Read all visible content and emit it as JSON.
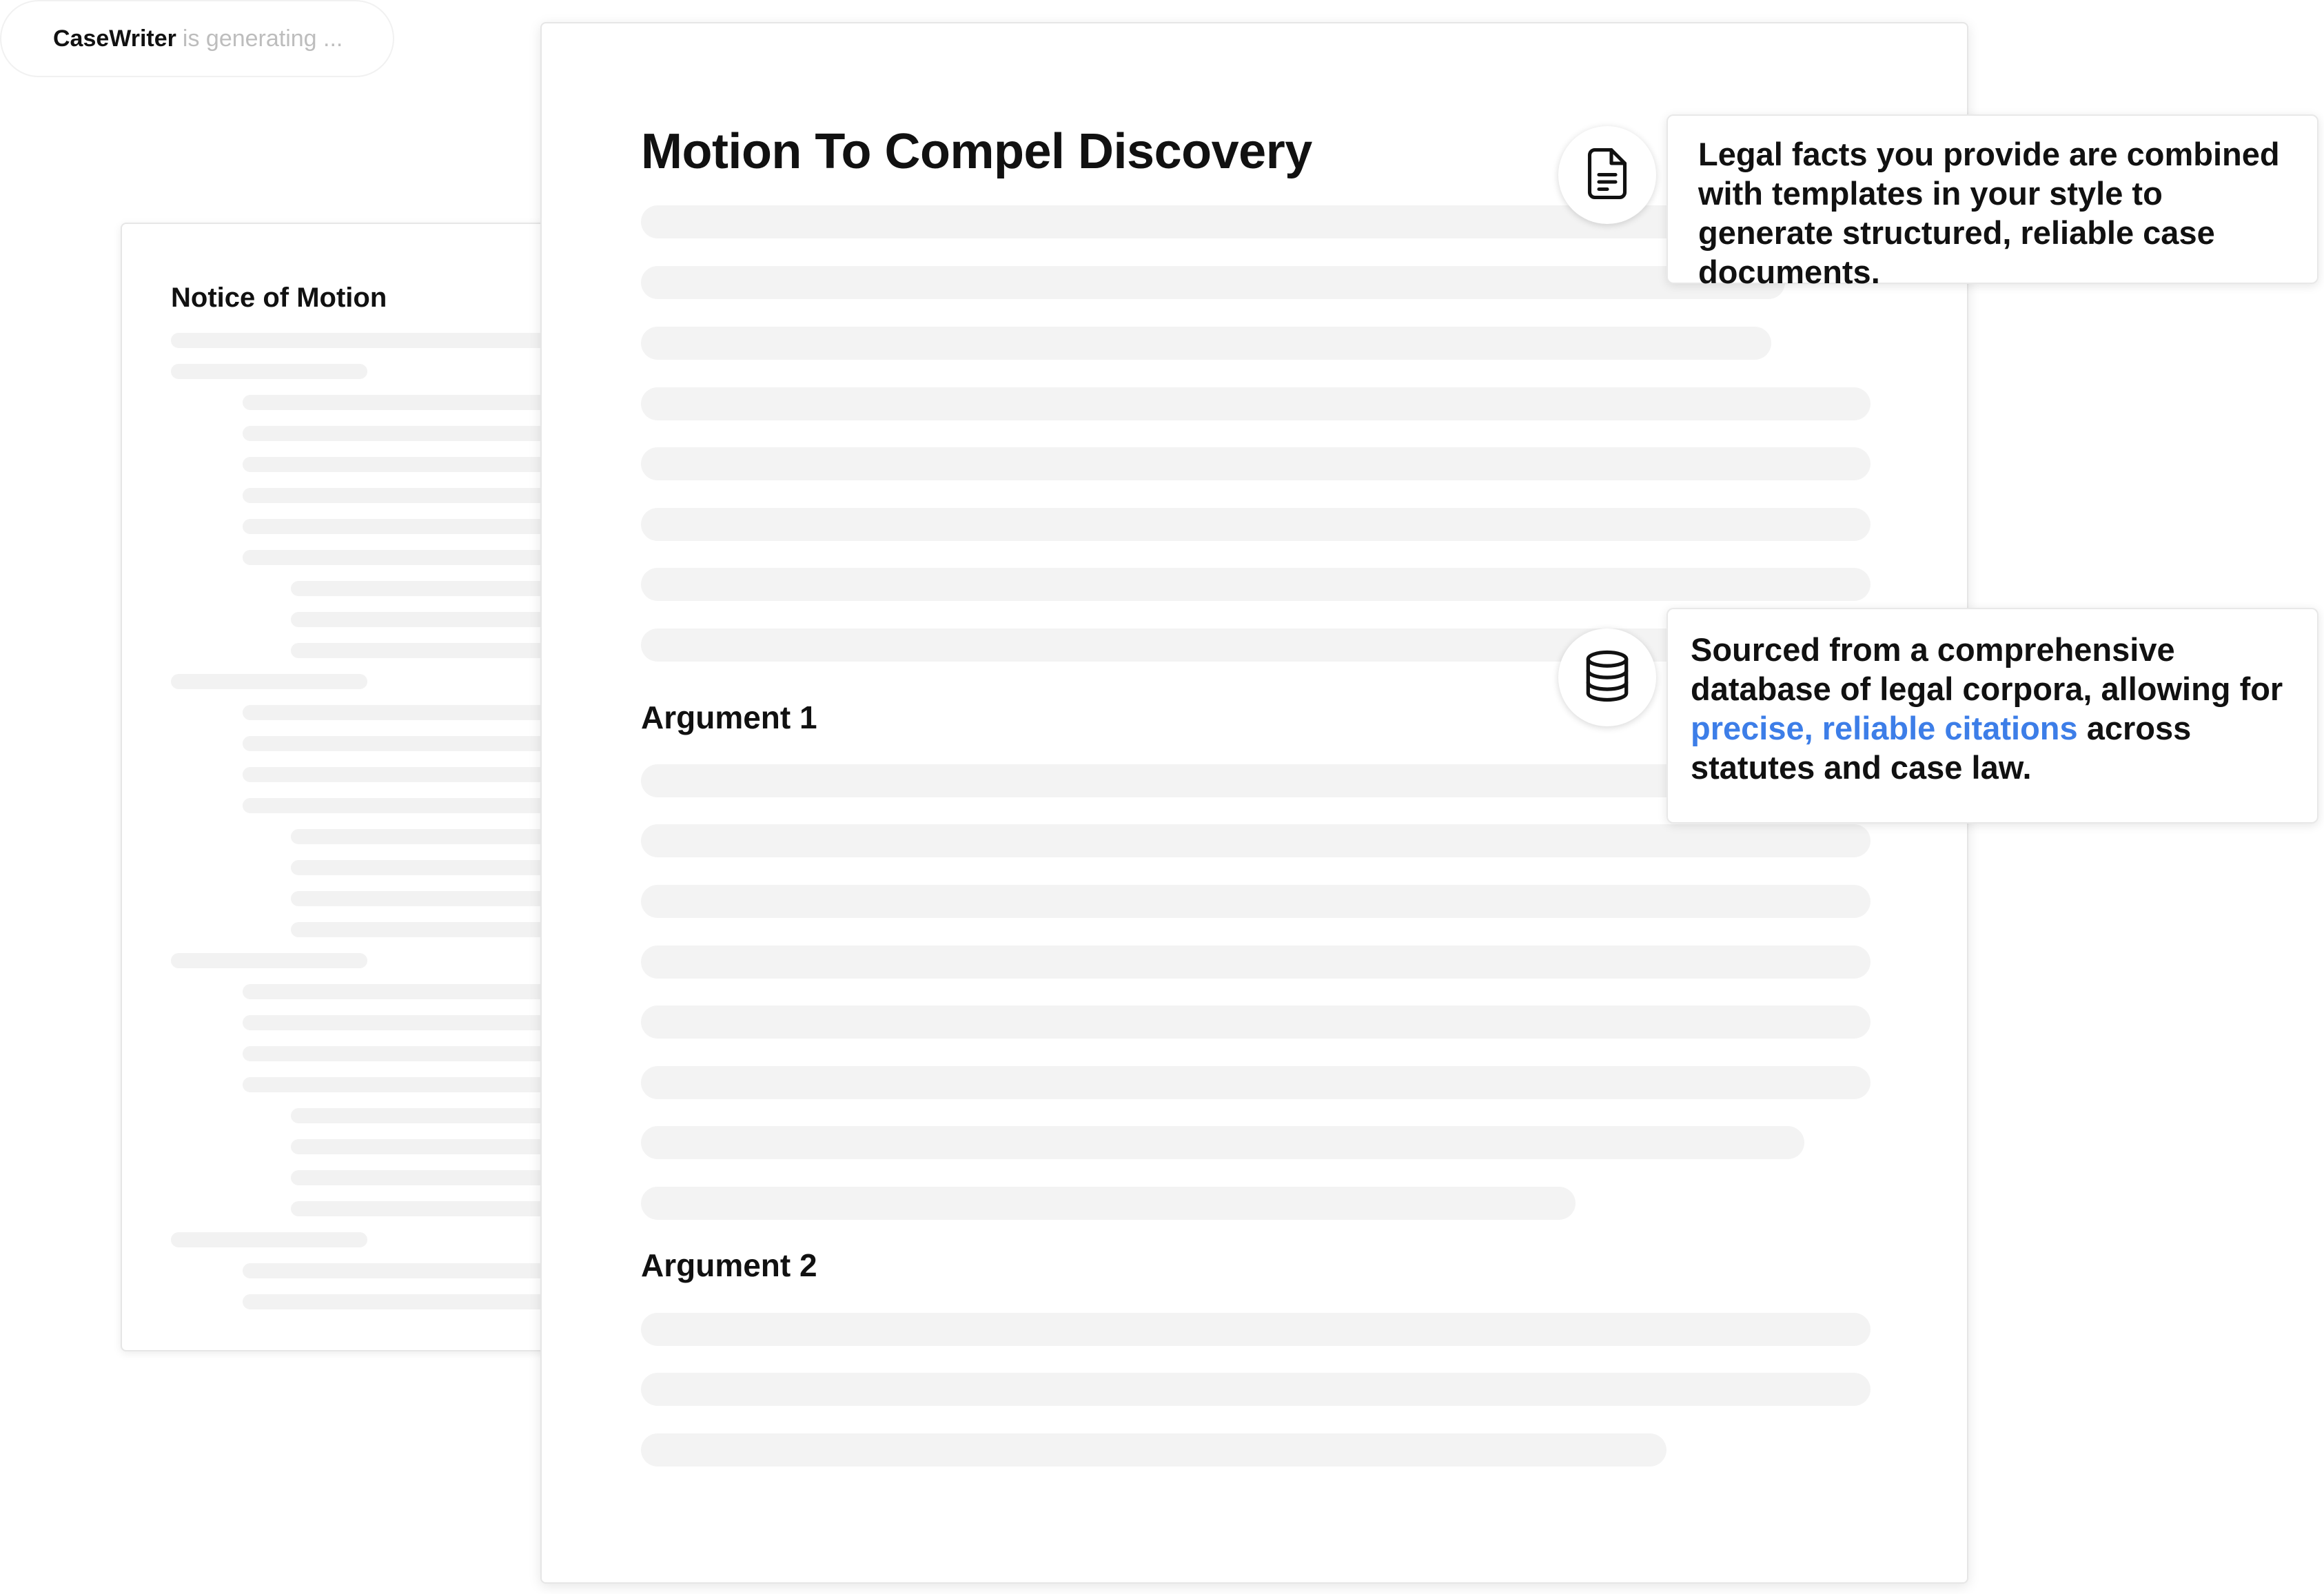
{
  "status": {
    "brand": "CaseWriter",
    "message": "is generating ..."
  },
  "back_document": {
    "title": "Notice of Motion"
  },
  "main_document": {
    "title": "Motion To Compel Discovery",
    "sections": [
      {
        "heading": "Argument 1"
      },
      {
        "heading": "Argument 2"
      }
    ]
  },
  "callouts": [
    {
      "icon": "document-icon",
      "text": "Legal facts you provide are combined with templates in your style to generate structured, reliable case documents."
    },
    {
      "icon": "database-icon",
      "text_before": "Sourced from a comprehensive database of legal corpora, allowing for ",
      "text_highlight": "precise, reliable citations",
      "text_after": " across statutes and case law."
    }
  ],
  "colors": {
    "highlight": "#3d7ee8",
    "skeleton": "#f3f3f3"
  }
}
